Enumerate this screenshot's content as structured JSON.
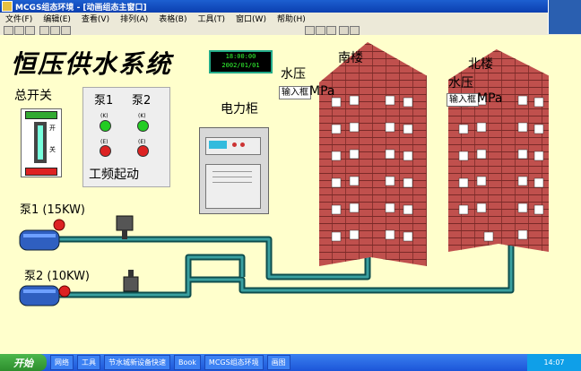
{
  "window": {
    "title": "MCGS组态环境 - [动画组态主窗口]"
  },
  "menu": [
    "文件(F)",
    "编辑(E)",
    "查看(V)",
    "排列(A)",
    "表格(B)",
    "工具(T)",
    "窗口(W)",
    "帮助(H)"
  ],
  "scada": {
    "title": "恒压供水系统",
    "clock_time": "18:00:00",
    "clock_date": "2002/01/01",
    "main_switch_label": "总开关",
    "switch_on": "开",
    "switch_off": "关",
    "pump1_label": "泵1",
    "pump2_label": "泵2",
    "btn_on_small": "开",
    "btn_off_small": "关",
    "mode_label": "工频起动",
    "cabinet_label": "电力柜",
    "south_bldg": "南楼",
    "north_bldg": "北楼",
    "pressure_label": "水压",
    "input_placeholder": "输入框",
    "unit": "MPa",
    "pump1_name": "泵1 (15KW)",
    "pump2_name": "泵2 (10KW)"
  },
  "colors": {
    "canvas": "#ffffcc",
    "brick": "#c0504d",
    "pipe": "#1f6f6f",
    "pipe_light": "#3aa0a0"
  },
  "taskbar": {
    "start": "开始",
    "items": [
      "网络",
      "工具",
      "节水城新设备快速",
      "Book",
      "MCGS组态环境",
      "画图"
    ],
    "tray": "14:07"
  }
}
